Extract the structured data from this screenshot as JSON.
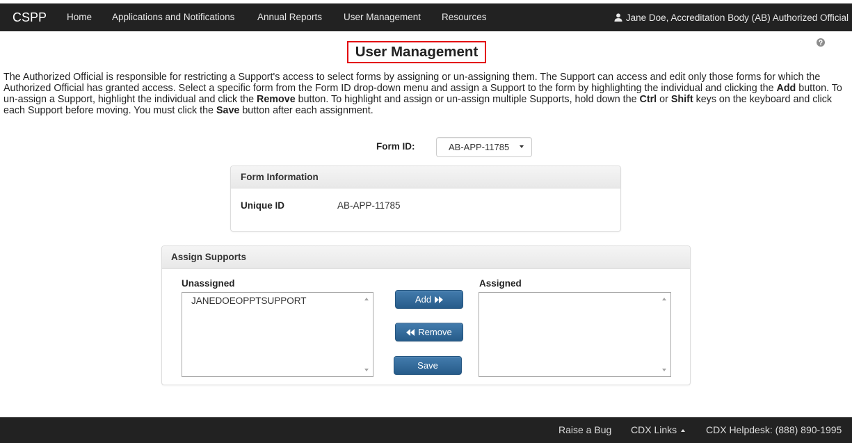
{
  "navbar": {
    "brand": "CSPP",
    "items": [
      {
        "label": "Home"
      },
      {
        "label": "Applications and Notifications"
      },
      {
        "label": "Annual Reports"
      },
      {
        "label": "User Management"
      },
      {
        "label": "Resources"
      }
    ],
    "user": {
      "icon": "user-icon",
      "label": "Jane Doe, Accreditation Body (AB) Authorized Official"
    }
  },
  "page": {
    "title": "User Management",
    "help_icon": "help-icon"
  },
  "intro": {
    "lines": [
      [
        "The Authorized Official is responsible for restricting a Support's access to select forms by assigning or un-assigning them. The Support can access and edit only those forms for which the"
      ],
      [
        "Authorized Official has granted access. Select a specific form from the Form ID drop-down menu and assign a Support to the form by highlighting the individual and clicking the ",
        "Add",
        " button. To"
      ],
      [
        "un-assign a Support, highlight the individual and click the ",
        "Remove",
        " button. To highlight and assign or un-assign multiple Supports, hold down the ",
        "Ctrl",
        " or ",
        "Shift",
        " keys on the keyboard and click"
      ],
      [
        "each Support before moving. You must click the ",
        "Save",
        " button after each assignment."
      ]
    ]
  },
  "form_select": {
    "label": "Form ID:",
    "selected": "AB-APP-11785",
    "icon": "caret-down-icon"
  },
  "form_info": {
    "heading": "Form Information",
    "unique_id_label": "Unique ID",
    "unique_id_value": "AB-APP-11785"
  },
  "assign": {
    "heading": "Assign Supports",
    "unassigned_label": "Unassigned",
    "assigned_label": "Assigned",
    "unassigned_items": [
      "JANEDOEOPPTSUPPORT"
    ],
    "assigned_items": [],
    "add_label": "Add",
    "add_icon": "forward-icon",
    "remove_label": "Remove",
    "remove_icon": "backward-icon",
    "save_label": "Save"
  },
  "footer": {
    "links": [
      {
        "label": "Raise a Bug"
      },
      {
        "label": "CDX Links",
        "icon": "caret-up-icon"
      },
      {
        "label": "CDX Helpdesk: (888) 890-1995"
      }
    ]
  },
  "colors": {
    "navbar_bg": "#222222",
    "footer_bg": "#222222",
    "primary_button": "#2e6da4",
    "title_highlight_border": "#e3000f",
    "help_icon": "#8c8c8c"
  }
}
